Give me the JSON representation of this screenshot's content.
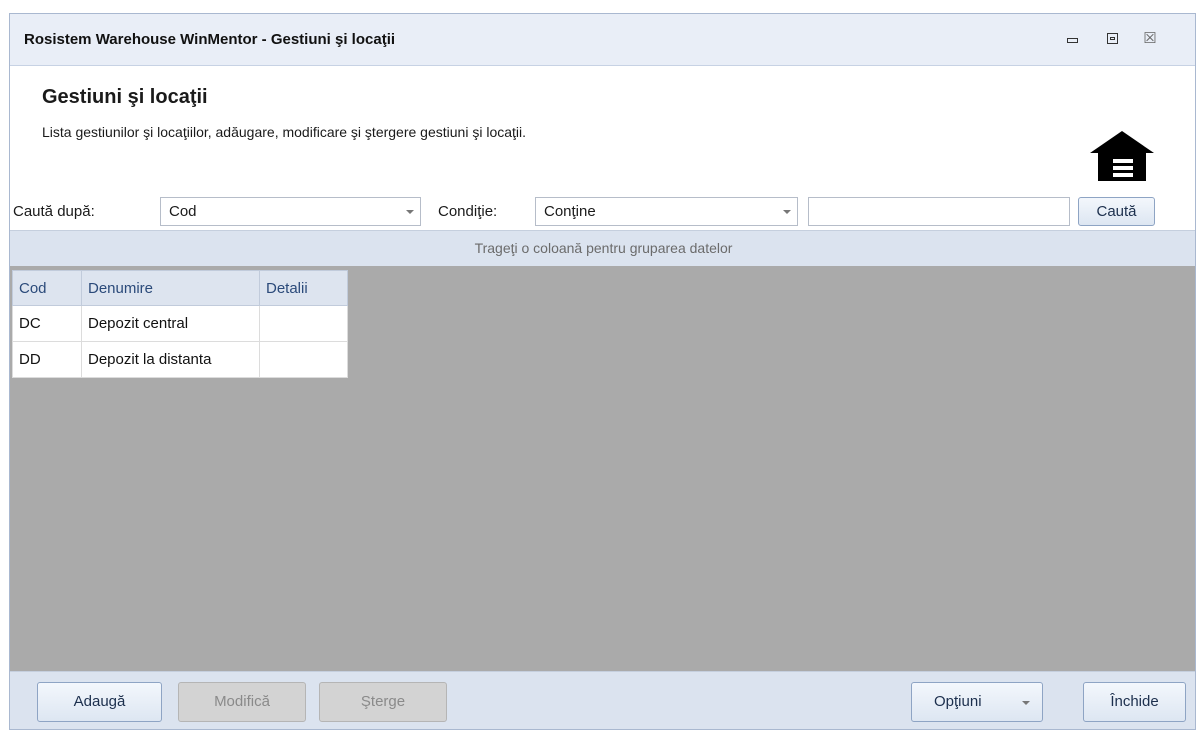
{
  "window": {
    "title": "Rosistem Warehouse WinMentor - Gestiuni şi locaţii",
    "close_glyph": "☒"
  },
  "header": {
    "heading": "Gestiuni şi locaţii",
    "subheading": "Lista gestiunilor şi locaţiilor, adăugare, modificare şi ştergere gestiuni şi locaţii.",
    "icon": "warehouse-icon"
  },
  "search": {
    "by_label": "Caută după:",
    "by_value": "Cod",
    "condition_label": "Condiţie:",
    "condition_value": "Conţine",
    "text_value": "",
    "button_label": "Caută"
  },
  "grid": {
    "group_hint": "Trageţi o coloană pentru gruparea datelor",
    "columns": [
      "Cod",
      "Denumire",
      "Detalii"
    ],
    "rows": [
      [
        "DC",
        "Depozit central",
        ""
      ],
      [
        "DD",
        "Depozit la distanta",
        ""
      ]
    ]
  },
  "footer": {
    "add_label": "Adaugă",
    "modify_label": "Modifică",
    "delete_label": "Şterge",
    "options_label": "Opţiuni",
    "close_label": "Închide"
  }
}
